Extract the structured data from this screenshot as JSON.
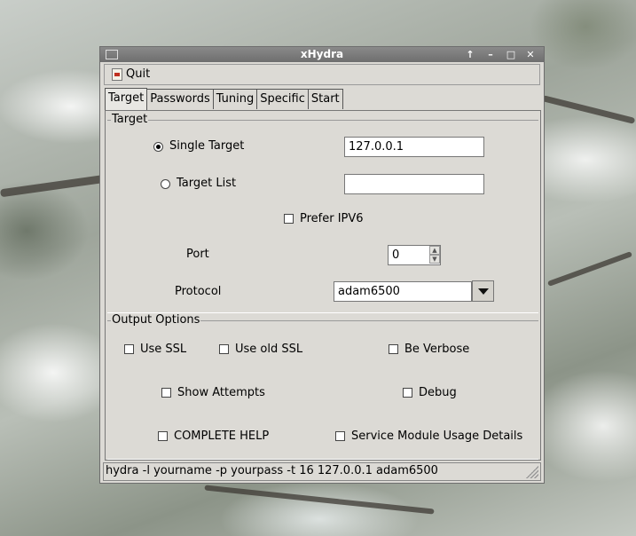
{
  "window": {
    "title": "xHydra",
    "controls": [
      "arrow-up-icon",
      "minimize-icon",
      "maximize-icon",
      "close-icon"
    ]
  },
  "menu": {
    "quit_label": "Quit"
  },
  "tabs": [
    "Target",
    "Passwords",
    "Tuning",
    "Specific",
    "Start"
  ],
  "target_group": {
    "legend": "Target",
    "single_target_label": "Single Target",
    "single_target_value": "127.0.0.1",
    "target_list_label": "Target List",
    "target_list_value": "",
    "prefer_ipv6_label": "Prefer IPV6",
    "port_label": "Port",
    "port_value": "0",
    "protocol_label": "Protocol",
    "protocol_value": "adam6500"
  },
  "output_group": {
    "legend": "Output Options",
    "use_ssl": "Use SSL",
    "use_old_ssl": "Use old SSL",
    "be_verbose": "Be Verbose",
    "show_attempts": "Show Attempts",
    "debug": "Debug",
    "complete_help": "COMPLETE HELP",
    "service_details": "Service Module Usage Details"
  },
  "status": {
    "command": "hydra -l yourname -p yourpass -t 16 127.0.0.1 adam6500"
  }
}
